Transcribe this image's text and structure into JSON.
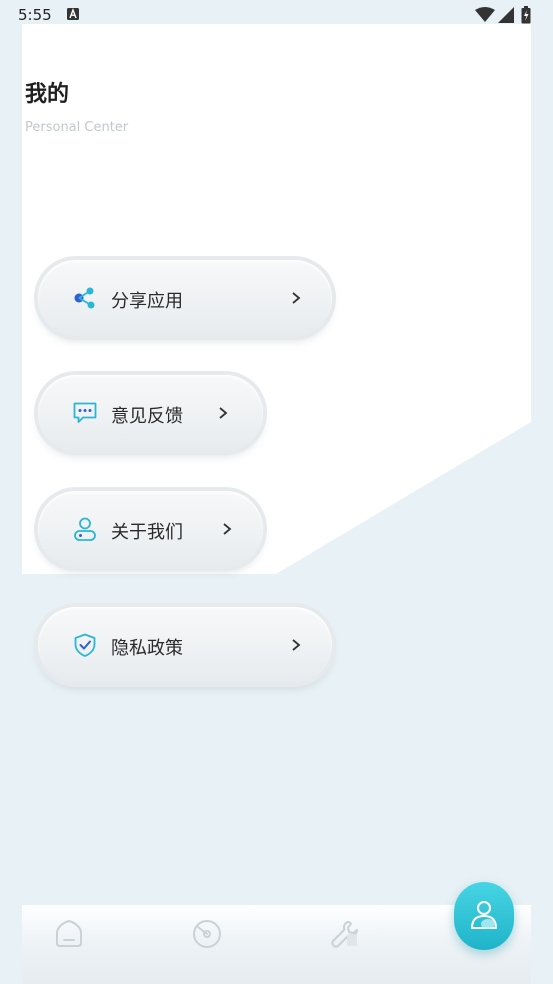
{
  "status_bar": {
    "time": "5:55"
  },
  "header": {
    "title": "我的",
    "subtitle": "Personal Center"
  },
  "menu": {
    "items": [
      {
        "label": "分享应用",
        "icon": "share-icon"
      },
      {
        "label": "意见反馈",
        "icon": "feedback-chat-icon"
      },
      {
        "label": "关于我们",
        "icon": "user-profile-icon"
      },
      {
        "label": "隐私政策",
        "icon": "shield-check-icon"
      }
    ]
  },
  "bottom_nav": {
    "items": [
      {
        "icon": "home-icon",
        "active": false
      },
      {
        "icon": "speedometer-icon",
        "active": false
      },
      {
        "icon": "wrench-icon",
        "active": false
      },
      {
        "icon": "user-icon",
        "active": true
      }
    ]
  },
  "colors": {
    "background": "#e8f1f5",
    "panel": "#ffffff",
    "accent": "#1fb3c9",
    "icon_blue": "#2f6fd6",
    "icon_cyan": "#2bb6d4"
  }
}
